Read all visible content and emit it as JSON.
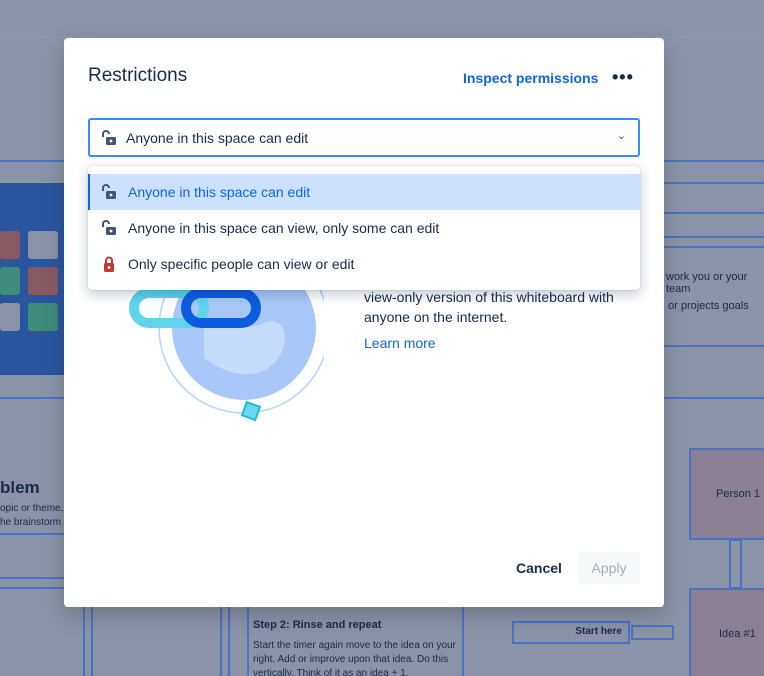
{
  "background": {
    "heading_fragment": "blem",
    "text_line1": "opic or theme.",
    "text_line2": "he brainstorm",
    "right_text1": "work you or your team",
    "right_text2": "or projects goals",
    "person_label": "Person 1",
    "idea_label": "Idea #1",
    "start_here": "Start here",
    "step2_title": "Step 2: Rinse and repeat",
    "step2_text": "Start the timer again move to the idea on your right. Add or improve upon that idea. Do this vertically. Think of it as an idea + 1."
  },
  "modal": {
    "title": "Restrictions",
    "inspect_link": "Inspect permissions",
    "more_label": "•••",
    "select": {
      "value": "Anyone in this space can edit"
    },
    "options": [
      {
        "label": "Anyone in this space can edit",
        "icon": "unlock-icon",
        "selected": true
      },
      {
        "label": "Anyone in this space can view, only some can edit",
        "icon": "unlock-icon",
        "selected": false
      },
      {
        "label": "Only specific people can view or edit",
        "icon": "lock-icon",
        "selected": false
      }
    ],
    "description": "view-only version of this whiteboard with anyone on the internet.",
    "learn_more": "Learn more",
    "cancel_label": "Cancel",
    "apply_label": "Apply"
  },
  "colors": {
    "accent": "#0c66e4",
    "selected_bg": "#cce0ff",
    "lock_red": "#c9372c",
    "overlay": "#8a93a7"
  }
}
